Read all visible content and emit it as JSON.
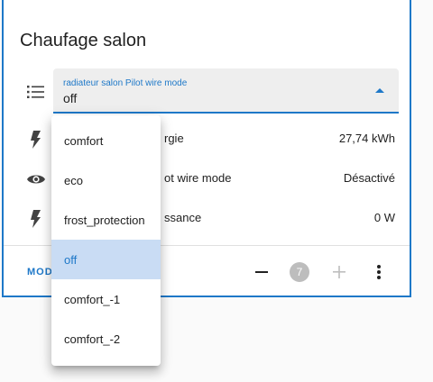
{
  "card": {
    "title": "Chaufage salon"
  },
  "select": {
    "label": "radiateur salon Pilot wire mode",
    "value": "off",
    "options": [
      "comfort",
      "eco",
      "frost_protection",
      "off",
      "comfort_-1",
      "comfort_-2"
    ],
    "selected_option": "off"
  },
  "entities": [
    {
      "icon": "flash-icon",
      "name_visible": "rgie",
      "value": "27,74 kWh"
    },
    {
      "icon": "eye-icon",
      "name_visible": "ot wire mode",
      "value": "Désactivé"
    },
    {
      "icon": "flash-icon",
      "name_visible": "ssance",
      "value": "0 W"
    }
  ],
  "footer": {
    "mode_label": "MOD",
    "counter": "7"
  },
  "colors": {
    "accent": "#1e78c8",
    "selected_bg": "#c9dcf4",
    "badge": "#bdbdbd"
  }
}
